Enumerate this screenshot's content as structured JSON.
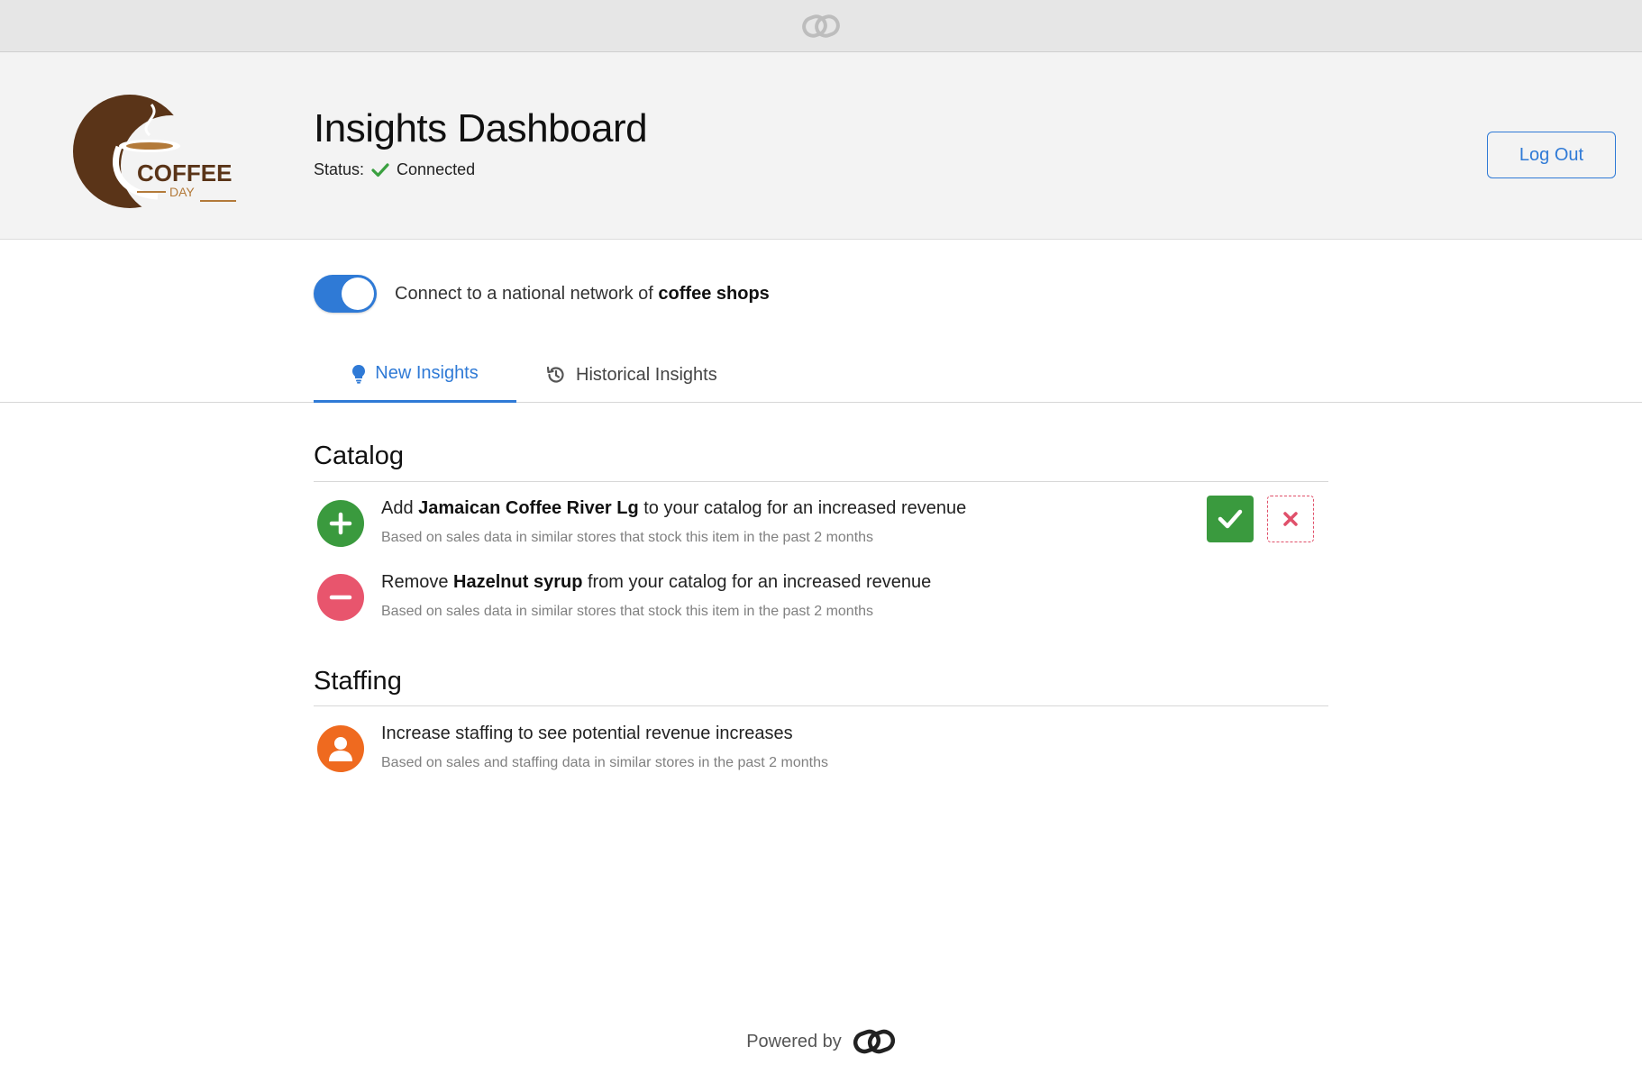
{
  "brand": {
    "logo_text": "COFFEE",
    "logo_subtext": "DAY",
    "mark_icon": "interlocking-rings-icon"
  },
  "header": {
    "title": "Insights Dashboard",
    "status_label": "Status:",
    "status_value": "Connected",
    "logout_label": "Log Out"
  },
  "network": {
    "enabled": true,
    "text_prefix": "Connect to a national network of",
    "text_bold": "coffee shops"
  },
  "tabs": [
    {
      "label": "New Insights",
      "icon": "lightbulb-icon",
      "active": true
    },
    {
      "label": "Historical Insights",
      "icon": "history-icon",
      "active": false
    }
  ],
  "sections": {
    "catalog": {
      "title": "Catalog",
      "items": [
        {
          "action": "add",
          "prefix": "Add",
          "bold": "Jamaican Coffee River Lg",
          "suffix": "to your catalog for an increased revenue",
          "sub": "Based on sales data in similar stores that stock this item in the past 2 months"
        },
        {
          "action": "remove",
          "prefix": "Remove",
          "bold": "Hazelnut syrup",
          "suffix": "from your catalog for an increased revenue",
          "sub": "Based on sales data in similar stores that stock this item in the past 2 months"
        }
      ]
    },
    "staffing": {
      "title": "Staffing",
      "items": [
        {
          "action": "staff",
          "text": "Increase staffing to see potential revenue increases",
          "sub": "Based on sales and staffing data in similar stores in the past 2 months"
        }
      ]
    }
  },
  "footer": {
    "powered_by": "Powered by"
  },
  "colors": {
    "accent": "#2f7ad6",
    "add": "#3a9a3e",
    "remove": "#e8556d",
    "staff": "#ef6a1f",
    "logo_brown": "#5a3418",
    "logo_gold": "#b37a3a"
  }
}
